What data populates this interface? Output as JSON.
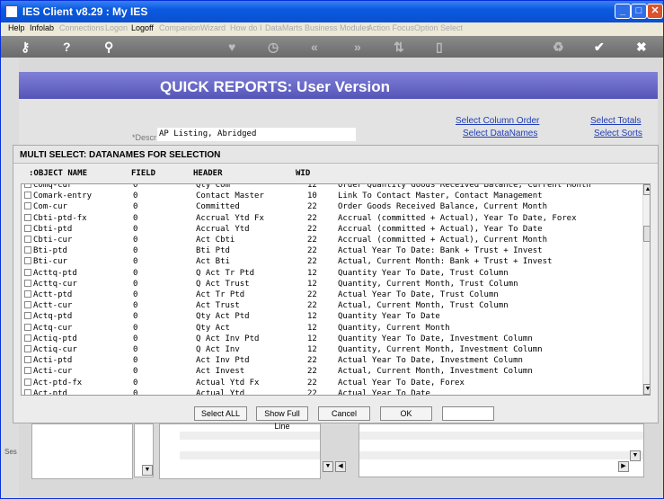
{
  "window": {
    "title": "IES Client v8.29 : My IES"
  },
  "menu": [
    {
      "label": "Help",
      "enabled": true
    },
    {
      "label": "Infolab",
      "enabled": true
    },
    {
      "label": "Connections",
      "enabled": false
    },
    {
      "label": "Logon",
      "enabled": false
    },
    {
      "label": "Logoff",
      "enabled": true
    },
    {
      "label": "Companion",
      "enabled": false
    },
    {
      "label": "Wizard",
      "enabled": false
    },
    {
      "label": "How do I",
      "enabled": false
    },
    {
      "label": "DataMarts",
      "enabled": false
    },
    {
      "label": "Business Modules",
      "enabled": false
    },
    {
      "label": "Action Focus",
      "enabled": false
    },
    {
      "label": "Option Select",
      "enabled": false
    }
  ],
  "toolbar_icons": [
    "key-icon",
    "help-icon",
    "search-icon",
    "heart-icon",
    "clock-icon",
    "rewind-icon",
    "fast-forward-icon",
    "sort-icon",
    "document-icon",
    "recycle-icon",
    "check-icon",
    "close-icon"
  ],
  "banner": {
    "title": "QUICK REPORTS: User Version"
  },
  "links": {
    "select_column_order": "Select Column Order",
    "select_totals": "Select Totals",
    "select_datanames": "Select DataNames",
    "select_sorts": "Select Sorts"
  },
  "descr": {
    "label": "*Descr",
    "value": "AP Listing, Abridged"
  },
  "modal": {
    "title": "MULTI SELECT: DATANAMES FOR SELECTION",
    "headers": {
      "object_name": ":OBJECT NAME",
      "field": "FIELD",
      "header": "HEADER",
      "wid": "WID"
    },
    "rows": [
      {
        "name": "Comq-cur",
        "field": "0",
        "header": "Qty Com",
        "wid": "12",
        "desc": "Order Quantity Goods Received Balance, Current Month"
      },
      {
        "name": "Comark-entry",
        "field": "0",
        "header": "Contact Master",
        "wid": "10",
        "desc": "Link To Contact Master, Contact Management"
      },
      {
        "name": "Com-cur",
        "field": "0",
        "header": "Committed",
        "wid": "22",
        "desc": "Order Goods Received Balance, Current Month"
      },
      {
        "name": "Cbti-ptd-fx",
        "field": "0",
        "header": "Accrual Ytd Fx",
        "wid": "22",
        "desc": "Accrual (committed + Actual), Year To Date, Forex"
      },
      {
        "name": "Cbti-ptd",
        "field": "0",
        "header": "Accrual Ytd",
        "wid": "22",
        "desc": "Accrual (committed + Actual), Year To Date"
      },
      {
        "name": "Cbti-cur",
        "field": "0",
        "header": "Act Cbti",
        "wid": "22",
        "desc": "Accrual (committed + Actual), Current Month"
      },
      {
        "name": "Bti-ptd",
        "field": "0",
        "header": "Bti Ptd",
        "wid": "22",
        "desc": "Actual Year To Date: Bank + Trust + Invest"
      },
      {
        "name": "Bti-cur",
        "field": "0",
        "header": "Act Bti",
        "wid": "22",
        "desc": "Actual, Current Month: Bank + Trust + Invest"
      },
      {
        "name": "Acttq-ptd",
        "field": "0",
        "header": "Q Act Tr Ptd",
        "wid": "12",
        "desc": "Quantity Year To Date, Trust Column"
      },
      {
        "name": "Acttq-cur",
        "field": "0",
        "header": "Q Act Trust",
        "wid": "12",
        "desc": "Quantity, Current Month, Trust Column"
      },
      {
        "name": "Actt-ptd",
        "field": "0",
        "header": "Act Tr Ptd",
        "wid": "22",
        "desc": "Actual Year To Date, Trust Column"
      },
      {
        "name": "Actt-cur",
        "field": "0",
        "header": "Act Trust",
        "wid": "22",
        "desc": "Actual, Current Month, Trust Column"
      },
      {
        "name": "Actq-ptd",
        "field": "0",
        "header": "Qty Act Ptd",
        "wid": "12",
        "desc": "Quantity Year To Date"
      },
      {
        "name": "Actq-cur",
        "field": "0",
        "header": "Qty Act",
        "wid": "12",
        "desc": "Quantity, Current Month"
      },
      {
        "name": "Actiq-ptd",
        "field": "0",
        "header": "Q Act Inv Ptd",
        "wid": "12",
        "desc": "Quantity Year To Date, Investment Column"
      },
      {
        "name": "Actiq-cur",
        "field": "0",
        "header": "Q Act Inv",
        "wid": "12",
        "desc": "Quantity, Current Month, Investment Column"
      },
      {
        "name": "Acti-ptd",
        "field": "0",
        "header": "Act Inv Ptd",
        "wid": "22",
        "desc": "Actual Year To Date, Investment Column"
      },
      {
        "name": "Acti-cur",
        "field": "0",
        "header": "Act Invest",
        "wid": "22",
        "desc": "Actual, Current Month, Investment Column"
      },
      {
        "name": "Act-ptd-fx",
        "field": "0",
        "header": "Actual Ytd Fx",
        "wid": "22",
        "desc": "Actual Year To Date, Forex"
      },
      {
        "name": "Act-ptd",
        "field": "0",
        "header": "Actual Ytd",
        "wid": "22",
        "desc": "Actual Year To Date"
      }
    ],
    "buttons": {
      "select_all": "Select ALL",
      "show_full_line": "Show Full Line",
      "cancel": "Cancel",
      "ok": "OK"
    }
  },
  "status": {
    "left_label": "Ses"
  }
}
